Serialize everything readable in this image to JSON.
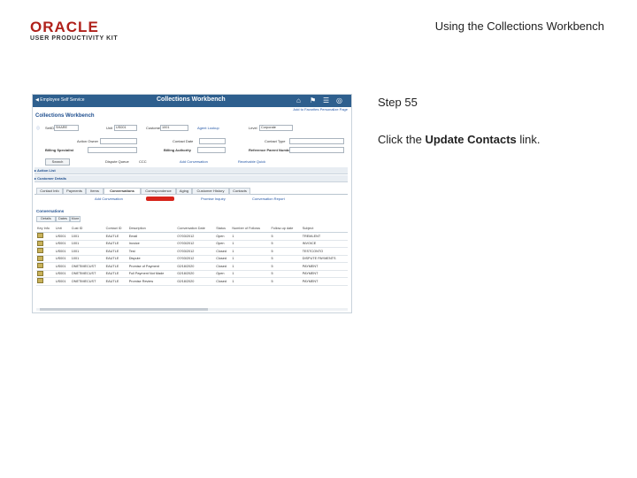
{
  "header": {
    "logo_top": "ORACLE",
    "logo_bottom": "USER PRODUCTIVITY KIT",
    "title": "Using the Collections Workbench"
  },
  "step": {
    "label": "Step 55"
  },
  "instruction": {
    "before": "Click the ",
    "bold": "Update Contacts",
    "after": " link."
  },
  "app": {
    "back_label": "Employee Self Service",
    "title": "Collections Workbench",
    "subheader_links": "Add to Favorites   Personalize Page",
    "page_title": "Collections Workbench",
    "fields": {
      "setid_label": "SetID",
      "setid_value": "SHARE",
      "unit_label": "Unit",
      "unit_value": "US001",
      "customer_label": "Customer",
      "customer_value": "1001",
      "agent_label": "Agent Lookup",
      "level_label": "Level",
      "level_value": "Corporate",
      "action_owner_label": "Action Owner",
      "conversation_label": "Contact Type",
      "conversation_date_label": "Contact Date",
      "billing_specialist_label": "Billing Specialist",
      "billing_authority_label": "Billing Authority",
      "reference_label": "Reference Parent Number",
      "search_btn": "Search",
      "dispute_label": "Dispute Queue",
      "dispute_value": "CCC",
      "add_conv_label": "Add Conversation",
      "treasurer_label": "Receivable Quick"
    },
    "sections": {
      "action_list": "Action List",
      "customer_details": "Customer Details"
    },
    "tabs": [
      "Contact Info",
      "Payments",
      "Items",
      "Conversations",
      "Correspondence",
      "Aging",
      "Customer History",
      "Contacts"
    ],
    "active_tab": "Conversations",
    "action_links": {
      "add_conversation": "Add Conversation",
      "promise_inquiry": "Promise Inquiry",
      "conversation_report": "Conversation Report"
    },
    "grid": {
      "title": "Conversations",
      "tabs": [
        "Details",
        "Dates",
        "More"
      ],
      "columns": [
        "Key Info",
        "Unit",
        "Cust ID",
        "Contact ID",
        "Description",
        "Conversation Date",
        "Status",
        "Number of Follows",
        "Follow-up date",
        "Subject"
      ],
      "rows": [
        [
          "",
          "US001",
          "1001",
          "EAUTLE",
          "Email",
          "07/03/2012",
          "Open",
          "1",
          "5",
          "TREMLENT"
        ],
        [
          "",
          "US001",
          "1001",
          "EAUTLE",
          "Invoice",
          "07/03/2012",
          "Open",
          "1",
          "5",
          "INVOICE"
        ],
        [
          "",
          "US001",
          "1001",
          "EAUTLE",
          "Test",
          "07/03/2012",
          "Closed",
          "1",
          "5",
          "TESTCONTO"
        ],
        [
          "",
          "US001",
          "1001",
          "EAUTLE",
          "Dispute",
          "07/03/2012",
          "Closed",
          "1",
          "5",
          "DISPUTE PAYMENTS"
        ],
        [
          "",
          "US001",
          "ONETIMECUST",
          "EAUTLE",
          "Promise of Payment",
          "02/18/2020",
          "Closed",
          "1",
          "5",
          "PAYMENT"
        ],
        [
          "",
          "US001",
          "ONETIMECUST",
          "EAUTLE",
          "Full Payment Not Made",
          "02/18/2020",
          "Open",
          "1",
          "5",
          "PAYMENT"
        ],
        [
          "",
          "US001",
          "ONETIMECUST",
          "EAUTLE",
          "Promise Review",
          "02/18/2020",
          "Closed",
          "1",
          "5",
          "PAYMENT"
        ]
      ]
    }
  }
}
